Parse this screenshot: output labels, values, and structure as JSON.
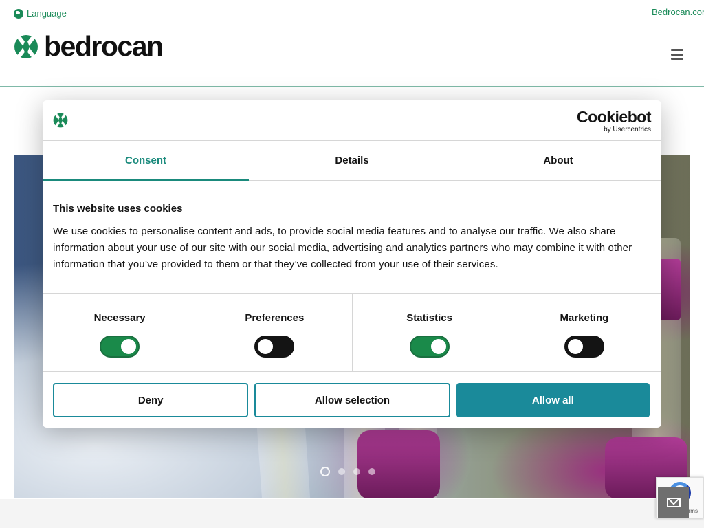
{
  "header": {
    "language_label": "Language",
    "site_link": "Bedrocan.com",
    "logo_text": "bedrocan",
    "brand_color": "#1a8a58"
  },
  "hero": {
    "slides_count": 4,
    "active_slide": 1
  },
  "cookie_dialog": {
    "brand": "Cookiebot",
    "brand_sub": "by Usercentrics",
    "tabs": [
      {
        "label": "Consent",
        "active": true
      },
      {
        "label": "Details",
        "active": false
      },
      {
        "label": "About",
        "active": false
      }
    ],
    "title": "This website uses cookies",
    "body": "We use cookies to personalise content and ads, to provide social media features and to analyse our traffic. We also share information about your use of our site with our social media, advertising and analytics partners who may combine it with other information that you’ve provided to them or that they’ve collected from your use of their services.",
    "toggles": [
      {
        "label": "Necessary",
        "state": "on"
      },
      {
        "label": "Preferences",
        "state": "off"
      },
      {
        "label": "Statistics",
        "state": "on"
      },
      {
        "label": "Marketing",
        "state": "off"
      }
    ],
    "buttons": {
      "deny": "Deny",
      "allow_selection": "Allow selection",
      "allow_all": "Allow all"
    },
    "accent_color": "#1a8a9a"
  },
  "recaptcha": {
    "text": "Privacy - Terms"
  },
  "icons": [
    "globe-icon",
    "bedrocan-logo-icon",
    "hamburger-menu-icon",
    "envelope-icon",
    "recaptcha-icon"
  ]
}
